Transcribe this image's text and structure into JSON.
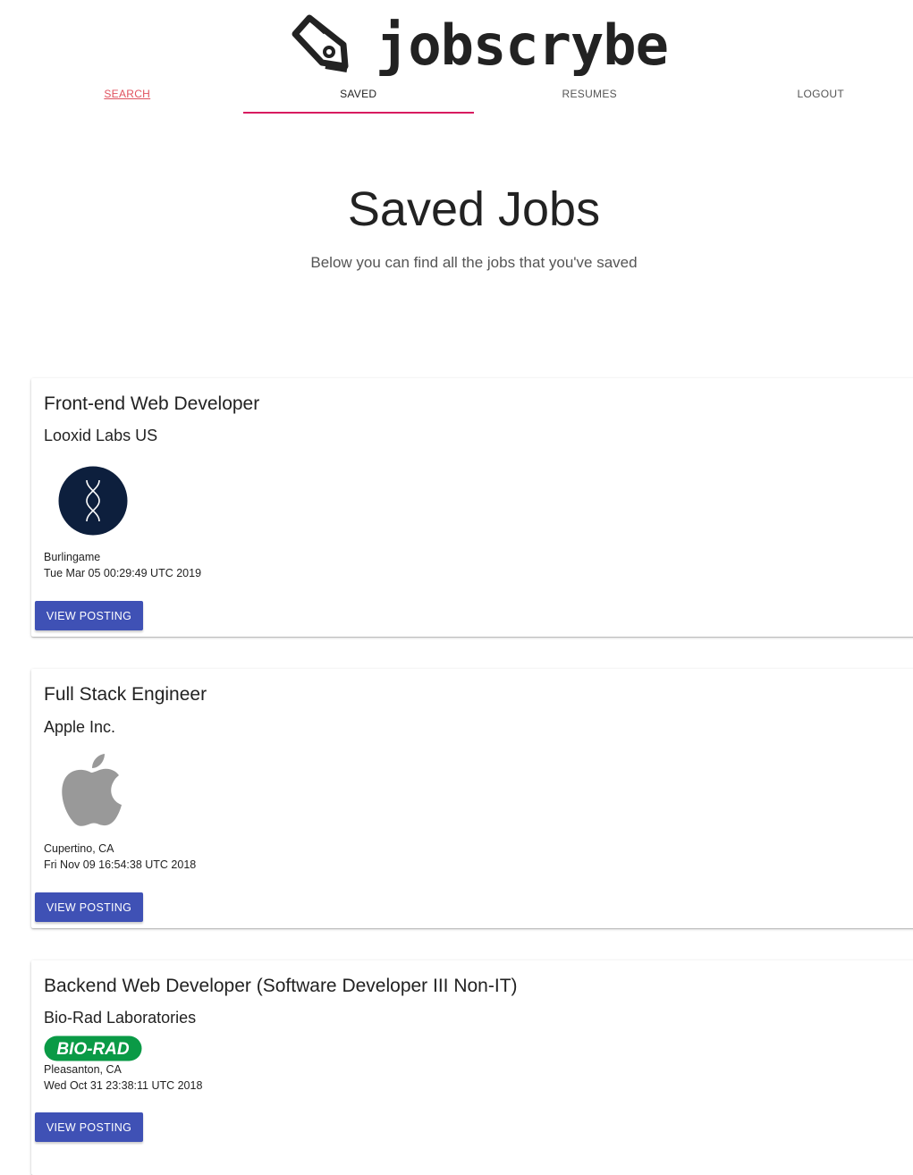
{
  "brand": {
    "name": "jobscrybe"
  },
  "nav": {
    "tabs": [
      {
        "label": "SEARCH",
        "state": "link"
      },
      {
        "label": "SAVED",
        "state": "active"
      },
      {
        "label": "RESUMES",
        "state": "normal"
      },
      {
        "label": "LOGOUT",
        "state": "normal"
      }
    ],
    "active_color": "#d81b60"
  },
  "page": {
    "title": "Saved Jobs",
    "subtitle": "Below you can find all the jobs that you've saved"
  },
  "jobs": [
    {
      "title": "Front-end Web Developer",
      "company": "Looxid Labs US",
      "logo_icon": "looxid-labs-logo",
      "location": "Burlingame",
      "date": "Tue Mar 05 00:29:49 UTC 2019",
      "button_label": "VIEW POSTING"
    },
    {
      "title": "Full Stack Engineer",
      "company": "Apple Inc.",
      "logo_icon": "apple-logo",
      "location": "Cupertino, CA",
      "date": "Fri Nov 09 16:54:38 UTC 2018",
      "button_label": "VIEW POSTING"
    },
    {
      "title": "Backend Web Developer (Software Developer III Non-IT)",
      "company": "Bio-Rad Laboratories",
      "logo_icon": "bio-rad-logo",
      "logo_text": "BIO-RAD",
      "location": "Pleasanton, CA",
      "date": "Wed Oct 31 23:38:11 UTC 2018",
      "button_label": "VIEW POSTING"
    }
  ],
  "colors": {
    "button": "#3f51b5",
    "link": "#e0525f",
    "bio_rad_green": "#0a9a46",
    "looxid_navy": "#0d1f3d"
  }
}
